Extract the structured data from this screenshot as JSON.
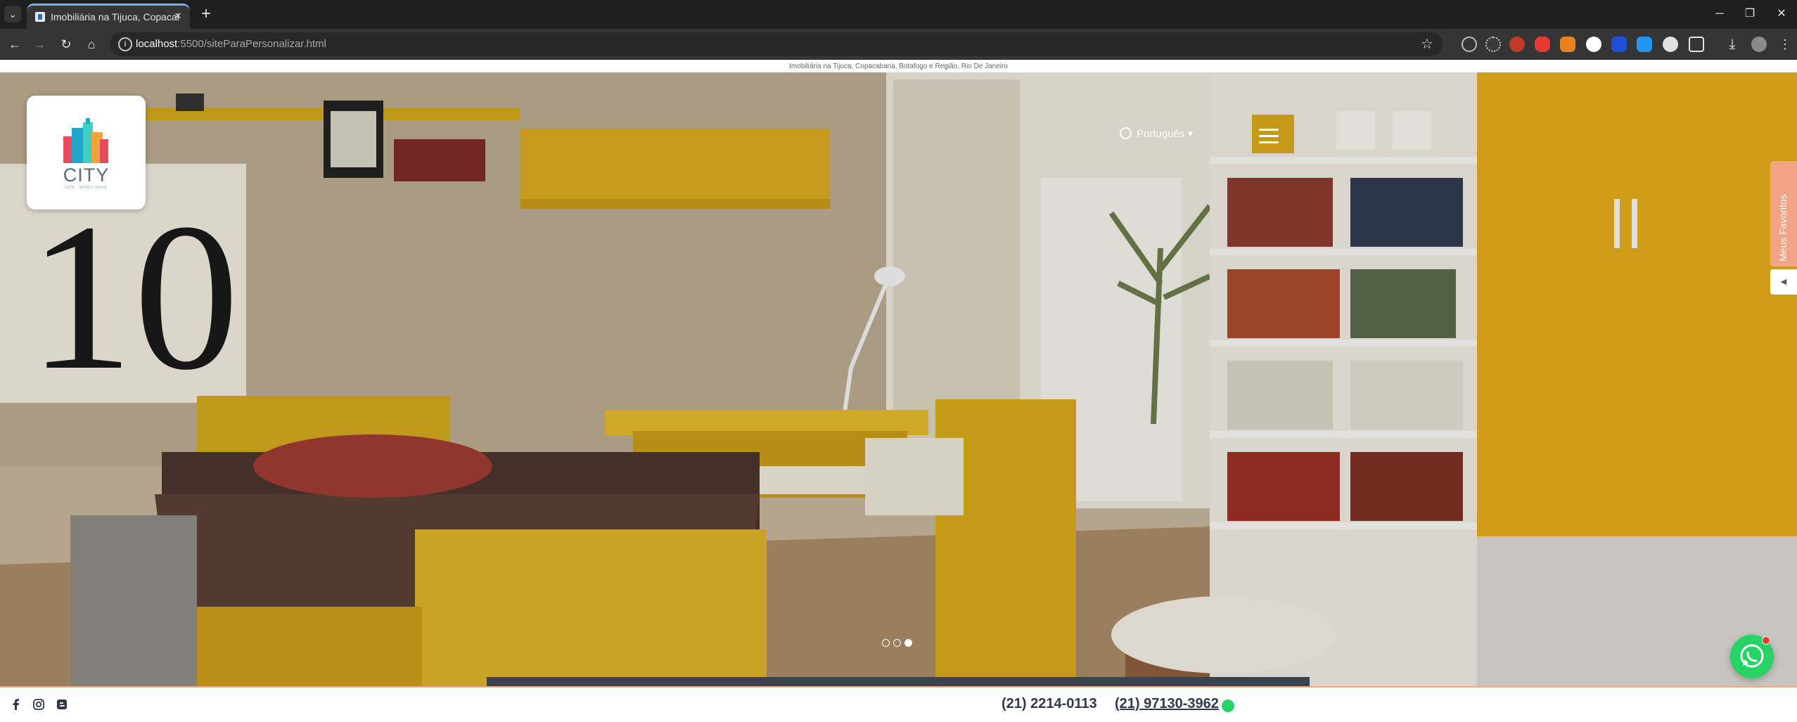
{
  "browser": {
    "tab_title": "Imobiliária na Tijuca, Copacaba",
    "url_host": "localhost",
    "url_rest": ":5500/siteParaPersonalizar.html"
  },
  "page": {
    "tagline": "Imobiliária na Tijuca, Copacabana, Botafogo e Região, Rio De Janeiro",
    "logo": {
      "name": "CITY",
      "subtitle": "ADM. IMOBILIÁRIA"
    },
    "language": {
      "selected": "Português"
    },
    "favorites_tab": {
      "label": "Meus Favoritos"
    },
    "slider": {
      "slide_count": 3,
      "active_index": 2
    },
    "footer": {
      "phone_primary": "(21) 2214-0113",
      "phone_whatsapp": "(21) 97130-3962"
    }
  },
  "colors": {
    "accent": "#f3a487",
    "whatsapp": "#25d366",
    "text_dark": "#2e3a4b"
  }
}
